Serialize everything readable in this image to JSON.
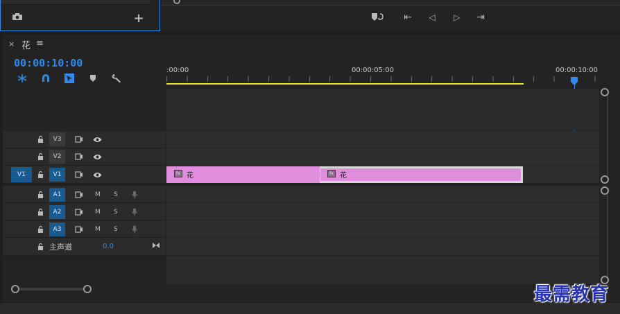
{
  "project_panel": {
    "camera_icon": "camera-icon",
    "add_icon": "+"
  },
  "program_monitor": {
    "transport": {
      "add_marker": "marker-icon",
      "go_to_in": "⇤",
      "step_back": "◁",
      "step_forward": "▷",
      "go_to_out": "⇥"
    }
  },
  "timeline": {
    "close": "×",
    "sequence_name": "花",
    "menu": "≡",
    "timecode": "00:00:10:00",
    "ruler": {
      "labels": [
        ":00:00",
        "00:00:05:00",
        "00:00:10:00"
      ]
    },
    "video_tracks": [
      {
        "name": "V3",
        "source": ""
      },
      {
        "name": "V2",
        "source": ""
      },
      {
        "name": "V1",
        "source": "V1"
      }
    ],
    "audio_tracks": [
      {
        "name": "A1",
        "mute": "M",
        "solo": "S"
      },
      {
        "name": "A2",
        "mute": "M",
        "solo": "S"
      },
      {
        "name": "A3",
        "mute": "M",
        "solo": "S"
      }
    ],
    "master": {
      "label": "主声道",
      "value": "0.0"
    },
    "clips": [
      {
        "label": "花",
        "fx": "fx"
      },
      {
        "label": "花",
        "fx": "fx"
      }
    ],
    "colors": {
      "accent": "#2d8ceb",
      "clip": "#e08de0",
      "work_area": "#e8e22a"
    }
  },
  "watermark": "最需教育"
}
